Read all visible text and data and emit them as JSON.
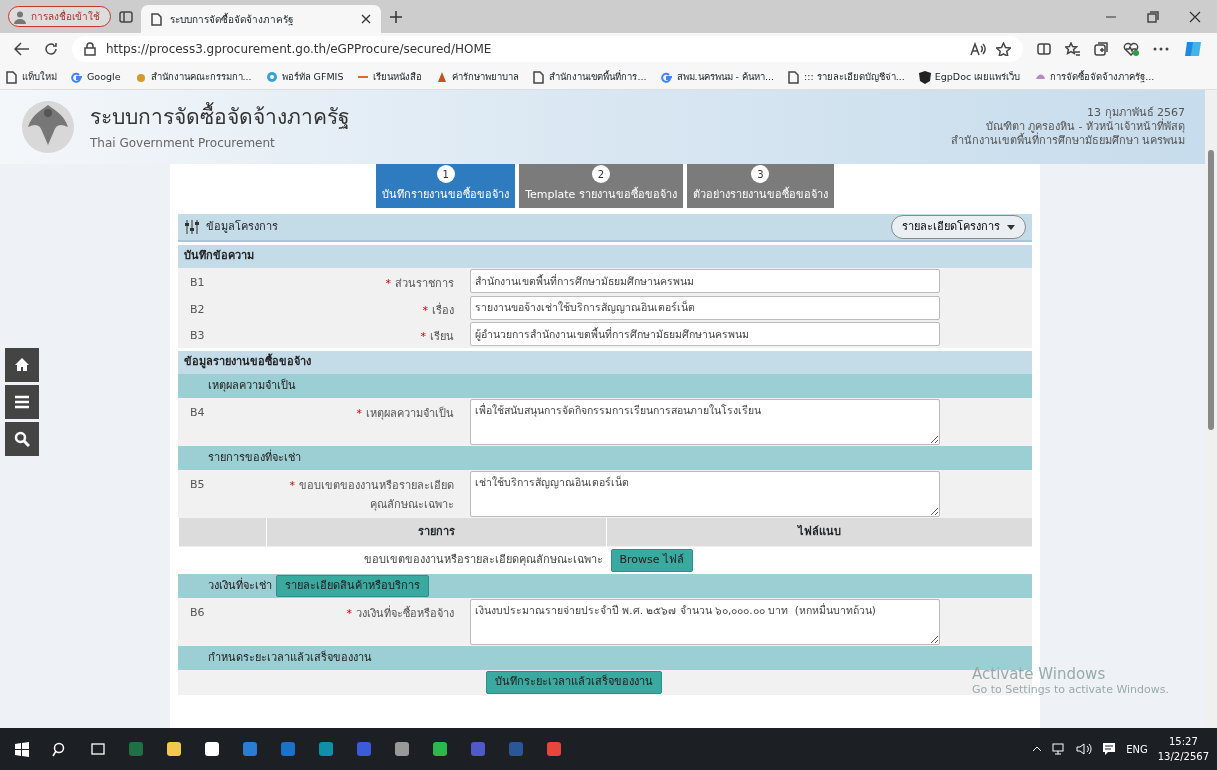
{
  "browser": {
    "profile_label": "การลงชื่อเข้าใช้",
    "tabs": [
      {
        "title": "ระบบการจัดซื้อจัดจ้างภาครัฐ",
        "selected": true
      }
    ],
    "url": "https://process3.gprocurement.go.th/eGPProcure/secured/HOME",
    "bookmarks": [
      "แท็บใหม่",
      "Google",
      "สำนักงานคณะกรรมกา...",
      "พอร์ทัล GFMIS",
      "เรียนหนังสือ",
      "ค่ารักษาพยาบาล",
      "สำนักงานเขตพื้นที่การ...",
      "สพม.นครพนม - ค้นหา...",
      "::: รายละเอียดบัญชีจ่า...",
      "EgpDoc เผยแพร่เว็บ",
      "การจัดซื้อจัดจ้างภาครัฐ..."
    ]
  },
  "header": {
    "title": "ระบบการจัดซื้อจัดจ้างภาครัฐ",
    "subtitle": "Thai Government Procurement",
    "date": "13 กุมภาพันธ์ 2567",
    "user": "บัณฑิตา ภูครองหิน - หัวหน้าเจ้าหน้าที่พัสดุ",
    "org": "สำนักงานเขตพื้นที่การศึกษามัธยมศึกษา นครพนม"
  },
  "steps": [
    {
      "number": "1",
      "label": "บันทึกรายงานขอซื้อขอจ้าง",
      "selected": true
    },
    {
      "number": "2",
      "label": "Template รายงานขอซื้อขอจ้าง",
      "selected": false
    },
    {
      "number": "3",
      "label": "ตัวอย่างรายงานขอซื้อขอจ้าง",
      "selected": false
    }
  ],
  "project_bar": {
    "title": "ข้อมูลโครงการ",
    "dropdown": "รายละเอียดโครงการ"
  },
  "form": [
    {
      "kind": "section",
      "title": "บันทึกข้อความ"
    },
    {
      "kind": "field",
      "code": "B1",
      "required_mark": "*",
      "label": [
        "ส่วนราชการ"
      ],
      "value": "สำนักงานเขตพื้นที่การศึกษามัธยมศึกษานครพนม",
      "multiline": false
    },
    {
      "kind": "field",
      "code": "B2",
      "required_mark": "*",
      "label": [
        "เรื่อง"
      ],
      "value": "รายงานขอจ้างเช่าใช้บริการสัญญาณอินเตอร์เน็ต",
      "multiline": false
    },
    {
      "kind": "field",
      "code": "B3",
      "required_mark": "*",
      "label": [
        "เรียน"
      ],
      "value": "ผู้อำนวยการสำนักงานเขตพื้นที่การศึกษามัธยมศึกษานครพนม",
      "multiline": false
    },
    {
      "kind": "section",
      "title": "ข้อมูลรายงานขอซื้อขอจ้าง"
    },
    {
      "kind": "subsection",
      "title": "เหตุผลความจำเป็น"
    },
    {
      "kind": "field",
      "code": "B4",
      "required_mark": "*",
      "label": [
        "เหตุผลความจำเป็น"
      ],
      "value": "เพื่อใช้สนับสนุนการจัดกิจกรรมการเรียนการสอนภายในโรงเรียน",
      "multiline": true
    },
    {
      "kind": "subsection",
      "title": "รายการของที่จะเช่า"
    },
    {
      "kind": "field",
      "code": "B5",
      "required_mark": "*",
      "label": [
        "ขอบเขตของงานหรือรายละเอียด",
        "คุณลักษณะเฉพาะ"
      ],
      "value": "เช่าใช้บริการสัญญาณอินเตอร์เน็ต",
      "multiline": true
    },
    {
      "kind": "file_table",
      "columns": [
        "รายการ",
        "ไฟล์แนบ"
      ],
      "rows": [
        {
          "item": "ขอบเขตของงานหรือรายละเอียดคุณลักษณะเฉพาะ",
          "button": "Browse ไฟล์"
        }
      ]
    },
    {
      "kind": "subsection",
      "title": "วงเงินที่จะเช่า",
      "button": "รายละเอียดสินค้าหรือบริการ"
    },
    {
      "kind": "field",
      "code": "B6",
      "required_mark": "*",
      "label": [
        "วงเงินที่จะซื้อหรือจ้าง"
      ],
      "value": "เงินงบประมาณรายจ่ายประจำปี พ.ศ. ๒๕๖๗ จำนวน ๖๐,๐๐๐.๐๐ บาท  (หกหมื่นบาทถ้วน)",
      "multiline": true
    },
    {
      "kind": "subsection",
      "title": "กำหนดระยะเวลาแล้วเสร็จของงาน"
    },
    {
      "kind": "button_row",
      "button": "บันทึกระยะเวลาแล้วเสร็จของงาน"
    }
  ],
  "notice": {
    "title": "Activate Windows",
    "text": "Go to Settings to activate Windows."
  },
  "taskbar": {
    "language": "ENG",
    "time": "15:27",
    "date": "13/2/2567"
  }
}
